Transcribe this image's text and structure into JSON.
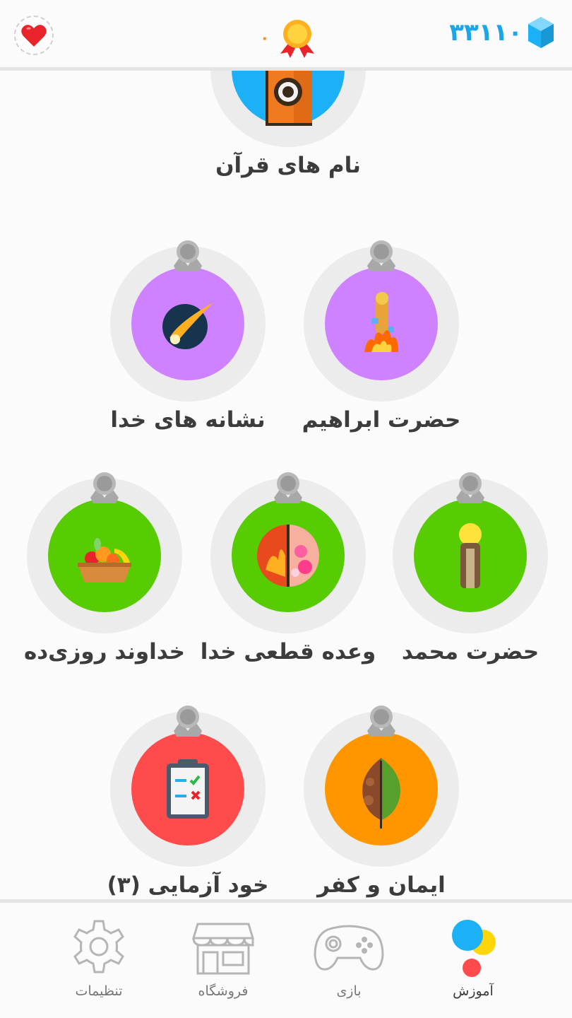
{
  "header": {
    "lives_icon": "heart-icon",
    "medal_count": "۰",
    "gem_count": "۳۳۱۱۰"
  },
  "skills": [
    {
      "label": "نام های قرآن",
      "color": "#1cb0f6",
      "icon": "quran-book-icon"
    },
    {
      "label": "حضرت ابراهیم",
      "color": "#ce82ff",
      "icon": "abraham-fire-icon"
    },
    {
      "label": "نشانه های خدا",
      "color": "#ce82ff",
      "icon": "comet-icon"
    },
    {
      "label": "حضرت محمد",
      "color": "#58cc02",
      "icon": "prophet-icon"
    },
    {
      "label": "وعده قطعی خدا",
      "color": "#58cc02",
      "icon": "heaven-hell-icon"
    },
    {
      "label": "خداوند روزی‌ده",
      "color": "#58cc02",
      "icon": "fruit-basket-icon"
    },
    {
      "label": "ایمان و کفر",
      "color": "#ff9600",
      "icon": "leaf-icon"
    },
    {
      "label": "خود آزمایی (۳)",
      "color": "#ff4b4b",
      "icon": "clipboard-icon"
    }
  ],
  "nav": {
    "learn": "آموزش",
    "game": "بازی",
    "shop": "فروشگاه",
    "settings": "تنظیمات"
  }
}
